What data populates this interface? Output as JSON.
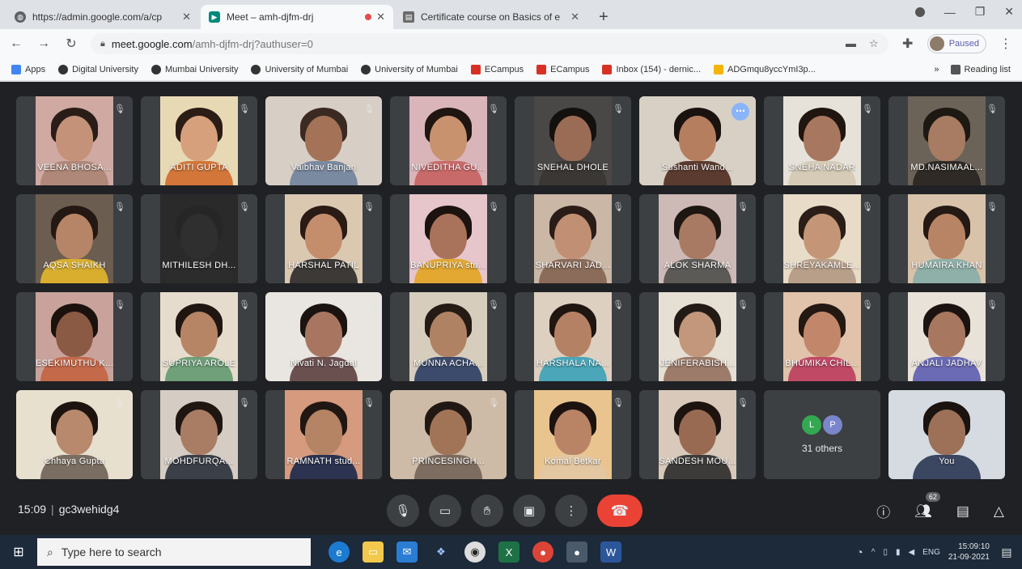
{
  "browser": {
    "tabs": [
      {
        "title": "https://admin.google.com/a/cp",
        "favicon_color": "#5f6368",
        "active": false,
        "recording": false
      },
      {
        "title": "Meet – amh-djfm-drj",
        "favicon_color": "#00897b",
        "active": true,
        "recording": true
      },
      {
        "title": "Certificate course on Basics of e",
        "favicon_color": "#6b6b6b",
        "active": false,
        "recording": false
      }
    ],
    "new_tab": "+",
    "address": {
      "host": "meet.google.com",
      "path": "/amh-djfm-drj?authuser=0"
    },
    "profile_label": "Paused",
    "bookmarks": [
      {
        "label": "Apps",
        "color": "#4285f4"
      },
      {
        "label": "Digital University",
        "color": "#333333"
      },
      {
        "label": "Mumbai University",
        "color": "#333333"
      },
      {
        "label": "University of Mumbai",
        "color": "#333333"
      },
      {
        "label": "University of Mumbai",
        "color": "#333333"
      },
      {
        "label": "ECampus",
        "color": "#d93025"
      },
      {
        "label": "ECampus",
        "color": "#d93025"
      },
      {
        "label": "Inbox (154) - dernic...",
        "color": "#d93025"
      },
      {
        "label": "ADGmqu8yccYmI3p...",
        "color": "#f4b400"
      }
    ],
    "bookmarks_more": "»",
    "reading_list": "Reading list"
  },
  "meet": {
    "participants": [
      {
        "name": "VEENA BHOSA...",
        "bg": "#cfa9a2",
        "face": "#c39279",
        "hair": "#2a1d18",
        "torso": "#b0887a",
        "wide": false
      },
      {
        "name": "ADITI GUPTA",
        "bg": "#e8d9b5",
        "face": "#d7a07d",
        "hair": "#2b1c15",
        "torso": "#d2763a",
        "wide": false
      },
      {
        "name": "Vaibhav Banjan",
        "bg": "#d7cfc6",
        "face": "#a37257",
        "hair": "#3b2a22",
        "torso": "#7a8aa0",
        "wide": true
      },
      {
        "name": "NIVEDITHA GU...",
        "bg": "#d9b5b9",
        "face": "#c8926f",
        "hair": "#1f1511",
        "torso": "#c96a6a",
        "wide": false
      },
      {
        "name": "SNEHAL DHOLE",
        "bg": "#4a4846",
        "face": "#9b6c55",
        "hair": "#14100e",
        "torso": "#3a3734",
        "wide": false
      },
      {
        "name": "Sushanti Wand...",
        "bg": "#d8d0c4",
        "face": "#b57e5f",
        "hair": "#1a120f",
        "torso": "#5b3b30",
        "wide": true
      },
      {
        "name": "SNEHA NADAR",
        "bg": "#e6e2da",
        "face": "#a87760",
        "hair": "#20160f",
        "torso": "#d6cbb7",
        "wide": false
      },
      {
        "name": "MD.NASIMAAL...",
        "bg": "#6b6258",
        "face": "#a77c63",
        "hair": "#1e1813",
        "torso": "#2f2a26",
        "wide": false
      },
      {
        "name": "AQSA SHAIKH",
        "bg": "#6b5d4f",
        "face": "#b68567",
        "hair": "#241813",
        "torso": "#d9ae2f",
        "wide": false
      },
      {
        "name": "MITHILESH DH...",
        "bg": "#2a2a2a",
        "face": "#2f2f2f",
        "hair": "#262626",
        "torso": "#2c2c2c",
        "wide": false
      },
      {
        "name": "HARSHAL PATIL",
        "bg": "#dbc8b1",
        "face": "#c48d6c",
        "hair": "#2a1b14",
        "torso": "#3c3936",
        "wide": false
      },
      {
        "name": "BANUPRIYA stu...",
        "bg": "#e6c5cb",
        "face": "#a9725a",
        "hair": "#1c130f",
        "torso": "#e2a832",
        "wide": false
      },
      {
        "name": "SHARVARI JAD...",
        "bg": "#cbb7a6",
        "face": "#c18f73",
        "hair": "#2a1d17",
        "torso": "#8b6c5a",
        "wide": false
      },
      {
        "name": "ALOK SHARMA",
        "bg": "#cdb9b6",
        "face": "#a87963",
        "hair": "#1d1611",
        "torso": "#5c5a57",
        "wide": false
      },
      {
        "name": "SHREYAKAMLE...",
        "bg": "#e8dcc9",
        "face": "#c49677",
        "hair": "#2b1e18",
        "torso": "#b89f8a",
        "wide": false
      },
      {
        "name": "HUMAIRA KHAN",
        "bg": "#d9c2aa",
        "face": "#b88466",
        "hair": "#241913",
        "torso": "#8fb0a8",
        "wide": false
      },
      {
        "name": "ESEKIMUTHU K...",
        "bg": "#c9a39b",
        "face": "#8a5a44",
        "hair": "#1b120e",
        "torso": "#c46a4b",
        "wide": false
      },
      {
        "name": "SUPRIYA AROLE",
        "bg": "#e6dccd",
        "face": "#b58566",
        "hair": "#201611",
        "torso": "#6fa07a",
        "wide": false
      },
      {
        "name": "Nivati N. Jagdal",
        "bg": "#e9e5e0",
        "face": "#a87660",
        "hair": "#1b130f",
        "torso": "#6b5050",
        "wide": true
      },
      {
        "name": "MUNNA ACHA...",
        "bg": "#d7cdbd",
        "face": "#b08264",
        "hair": "#251a14",
        "torso": "#3c4b6b",
        "wide": false
      },
      {
        "name": "HARSHALA NA...",
        "bg": "#ddd0c1",
        "face": "#b58164",
        "hair": "#1f1511",
        "torso": "#4aa6b8",
        "wide": false
      },
      {
        "name": "JENIFERABISH...",
        "bg": "#e6dfd3",
        "face": "#c2977c",
        "hair": "#231a15",
        "torso": "#9c7b6a",
        "wide": false
      },
      {
        "name": "BHUMIKA CHIL...",
        "bg": "#e0c3aa",
        "face": "#c2876a",
        "hair": "#231812",
        "torso": "#c04a66",
        "wide": false
      },
      {
        "name": "ANJALI JADHAV",
        "bg": "#e9e2d8",
        "face": "#a8775f",
        "hair": "#1c1310",
        "torso": "#6b6ab5",
        "wide": false
      },
      {
        "name": "Chhaya Gupta",
        "bg": "#e8e0cf",
        "face": "#b8896d",
        "hair": "#1d1410",
        "torso": "#7a6e62",
        "wide": true
      },
      {
        "name": "MOHDFURQA...",
        "bg": "#d5cdc4",
        "face": "#a97c64",
        "hair": "#1f1612",
        "torso": "#3b3f47",
        "wide": false
      },
      {
        "name": "RAMNATH stud...",
        "bg": "#d69a7e",
        "face": "#b58465",
        "hair": "#211712",
        "torso": "#2c3350",
        "wide": false
      },
      {
        "name": "PRINCESINGH...",
        "bg": "#cdbba7",
        "face": "#a17458",
        "hair": "#221813",
        "torso": "#7d6d60",
        "wide": true
      },
      {
        "name": "Komal Betkar",
        "bg": "#e9c48e",
        "face": "#b98466",
        "hair": "#1c1310",
        "torso": "#e3c7a2",
        "wide": false
      },
      {
        "name": "SANDESH MOU...",
        "bg": "#d8c9bb",
        "face": "#996a52",
        "hair": "#1d1410",
        "torso": "#3d3b3a",
        "wide": false
      }
    ],
    "speaking_index": 5,
    "others": {
      "label": "31 others",
      "avatars": [
        {
          "letter": "L",
          "color": "#33a852"
        },
        {
          "letter": "P",
          "color": "#7986cb"
        }
      ]
    },
    "self": {
      "name": "You",
      "bg": "#d5dbe0",
      "face": "#9c7158",
      "hair": "#1b130f",
      "torso": "#3b4660"
    },
    "time": "15:09",
    "meeting_code": "gc3wehidg4",
    "participant_count": "62",
    "controls": {
      "mic": "mic-icon",
      "camera": "camera-icon",
      "hand": "raise-hand-icon",
      "present": "present-icon",
      "more": "more-icon",
      "end": "end-call-icon"
    }
  },
  "taskbar": {
    "search_placeholder": "Type here to search",
    "tray_lang": "ENG",
    "clock_time": "15:09:10",
    "clock_date": "21-09-2021"
  }
}
